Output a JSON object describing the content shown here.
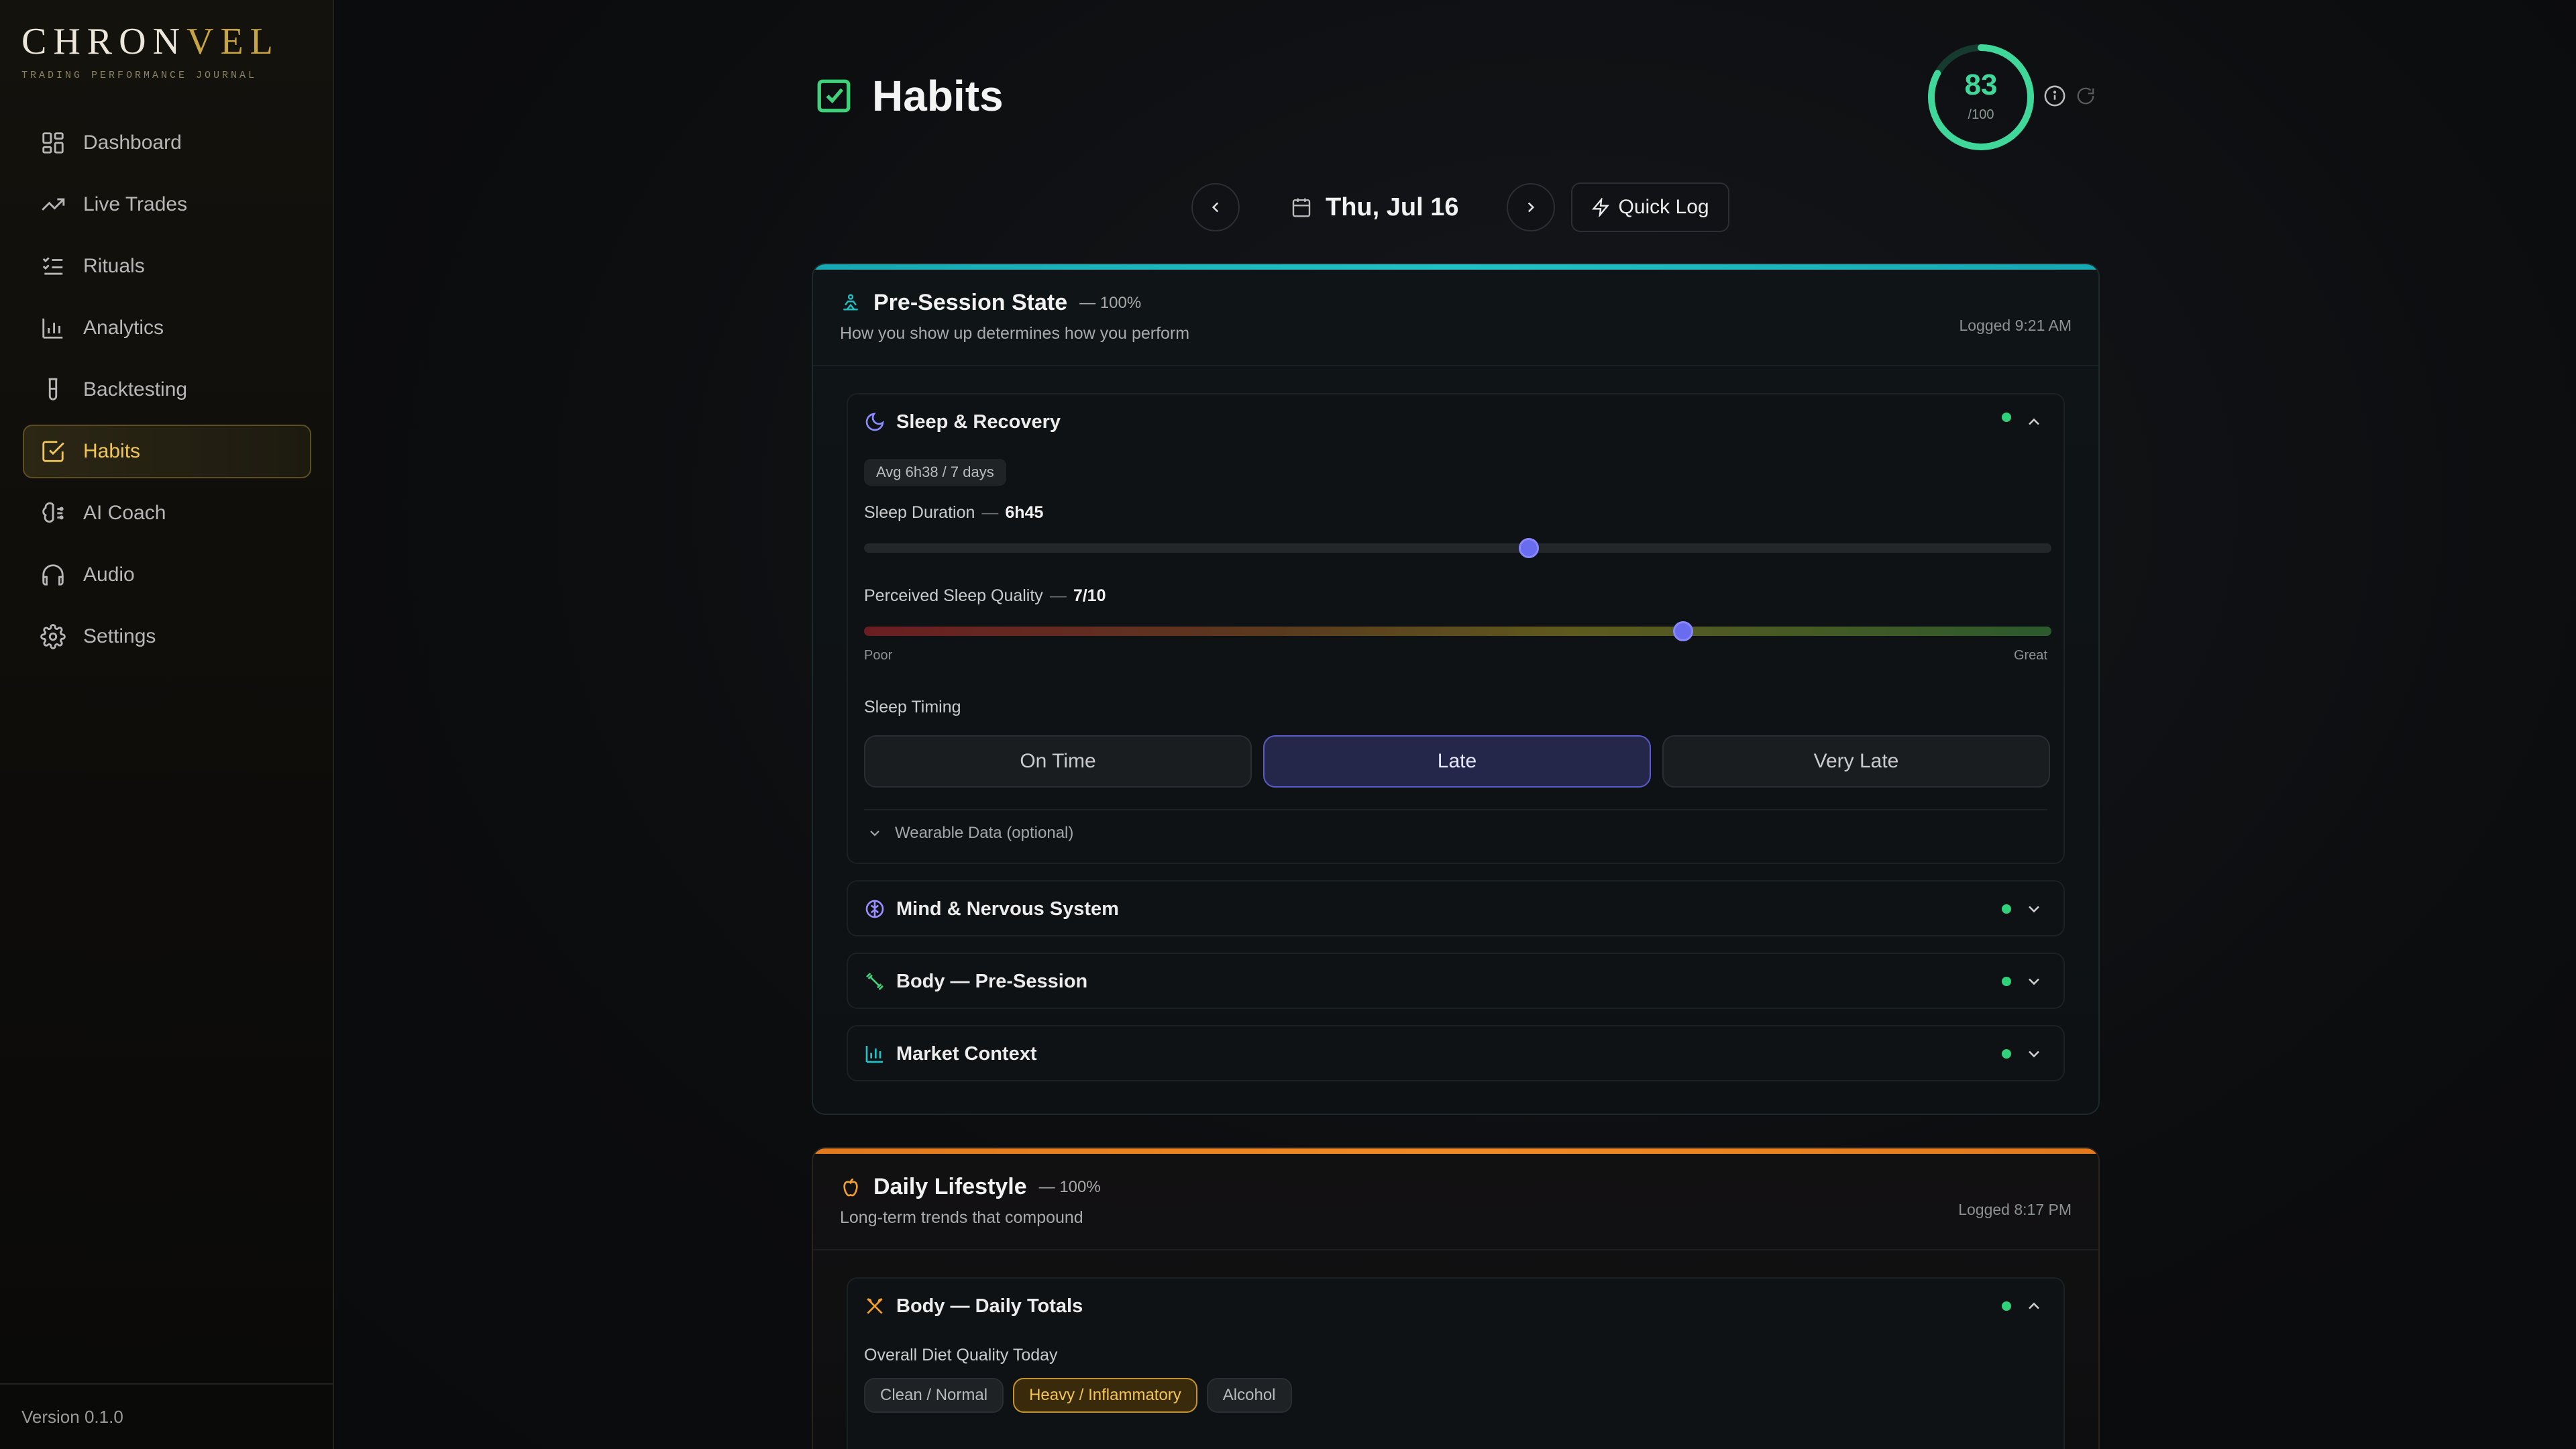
{
  "brand": {
    "name_plain": "CHRON",
    "name_accent": "VEL",
    "tagline": "TRADING PERFORMANCE JOURNAL"
  },
  "sidebar": {
    "items": [
      {
        "label": "Dashboard",
        "icon": "dashboard-icon"
      },
      {
        "label": "Live Trades",
        "icon": "trend-up-icon"
      },
      {
        "label": "Rituals",
        "icon": "checklist-icon"
      },
      {
        "label": "Analytics",
        "icon": "bar-chart-icon"
      },
      {
        "label": "Backtesting",
        "icon": "test-tube-icon"
      },
      {
        "label": "Habits",
        "icon": "check-square-icon",
        "active": true
      },
      {
        "label": "AI Coach",
        "icon": "brain-icon"
      },
      {
        "label": "Audio",
        "icon": "headphones-icon"
      },
      {
        "label": "Settings",
        "icon": "gear-icon"
      }
    ],
    "version": "Version 0.1.0"
  },
  "page": {
    "title": "Habits",
    "score": {
      "value": "83",
      "max": "/100",
      "fraction": 0.83
    }
  },
  "date_nav": {
    "date": "Thu, Jul 16",
    "quick_log": "Quick Log"
  },
  "pre_session": {
    "title": "Pre-Session State",
    "pct": "— 100%",
    "subtitle": "How you show up determines how you perform",
    "logged": "Logged 9:21 AM",
    "sleep": {
      "title": "Sleep & Recovery",
      "avg": "Avg 6h38 / 7 days",
      "duration_label": "Sleep Duration",
      "duration_value": "6h45",
      "duration_fraction": 0.56,
      "quality_label": "Perceived Sleep Quality",
      "quality_value": "7/10",
      "quality_fraction": 0.69,
      "scale_low": "Poor",
      "scale_high": "Great",
      "timing_label": "Sleep Timing",
      "timing_options": [
        "On Time",
        "Late",
        "Very Late"
      ],
      "timing_selected": "Late",
      "wearable": "Wearable Data (optional)"
    },
    "collapsed": [
      {
        "title": "Mind & Nervous System",
        "icon": "brain-circuit-icon"
      },
      {
        "title": "Body — Pre-Session",
        "icon": "dumbbell-icon"
      },
      {
        "title": "Market Context",
        "icon": "bar-chart-icon"
      }
    ]
  },
  "daily_lifestyle": {
    "title": "Daily Lifestyle",
    "pct": "— 100%",
    "subtitle": "Long-term trends that compound",
    "logged": "Logged 8:17 PM",
    "body": {
      "title": "Body — Daily Totals",
      "diet_label": "Overall Diet Quality Today",
      "diet_options": [
        "Clean / Normal",
        "Heavy / Inflammatory",
        "Alcohol"
      ],
      "diet_selected": "Heavy / Inflammatory"
    }
  },
  "colors": {
    "accent_gold": "#f0c65a",
    "teal": "#21c2c7",
    "orange": "#f28a24",
    "score_green": "#3fd89a",
    "slider_thumb": "#6a6cf0",
    "status_dot": "#2fd27a"
  }
}
